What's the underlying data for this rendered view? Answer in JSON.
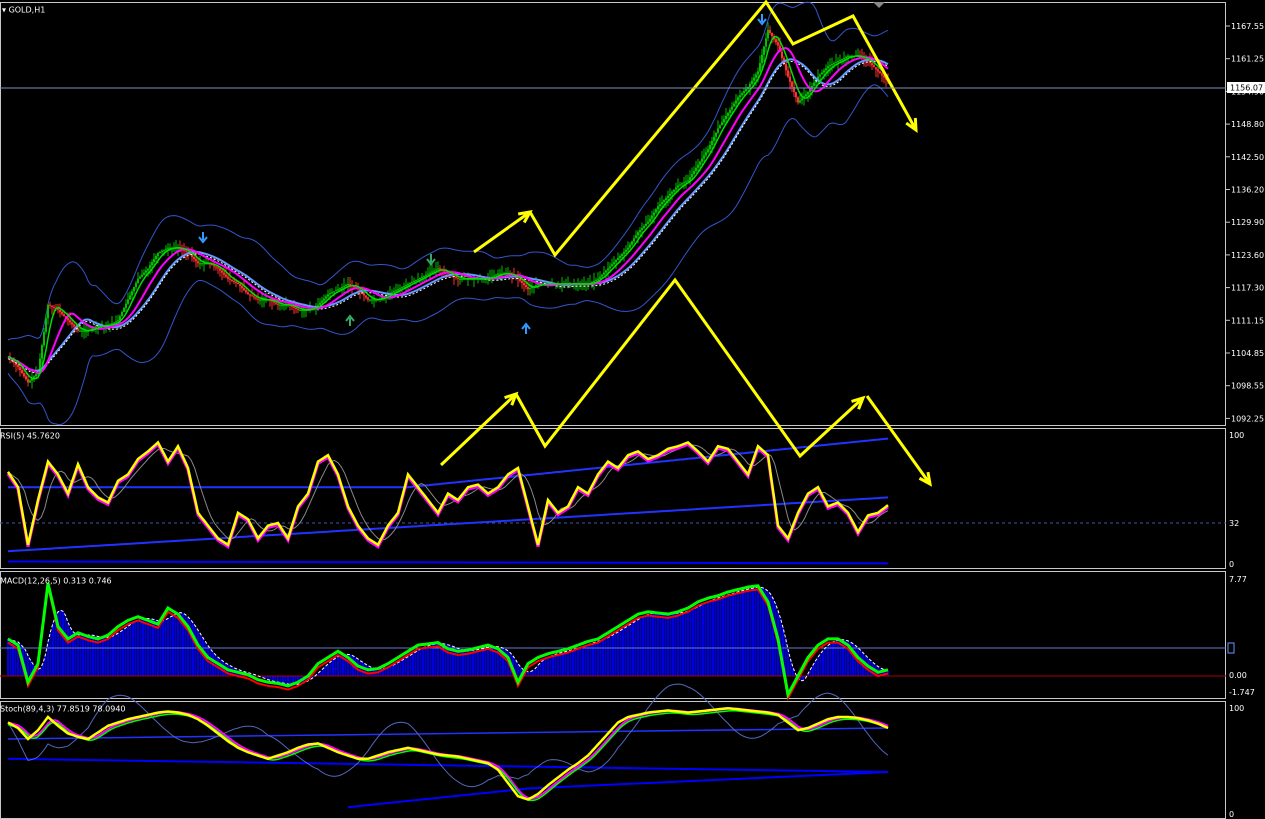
{
  "window": {
    "title": "GOLD,H1",
    "current_price": "1156.07"
  },
  "colors": {
    "background": "#000000",
    "bull_candle": "#00c000",
    "bear_candle": "#ff3030",
    "ma_fast": "#00e000",
    "ma_mid": "#ff00ff",
    "ma_slow": "#6699ff",
    "bands": "#3355cc",
    "rsi_line": "#ffff00",
    "macd_line": "#00ff00",
    "macd_hist": "#0000dd",
    "stoch_k": "#ffff00",
    "annotation_arrows": "#ffff00",
    "up_arrow": "#3399ff",
    "down_arrow": "#3399ff"
  },
  "price_panel": {
    "y_ticks": [
      "1167.55",
      "1161.25",
      "1154.90",
      "1148.80",
      "1142.50",
      "1136.20",
      "1129.90",
      "1123.60",
      "1117.30",
      "1111.15",
      "1104.85",
      "1098.55",
      "1092.25"
    ],
    "y_range": [
      1090,
      1171
    ]
  },
  "rsi_panel": {
    "header": "RSI(5) 45.7620",
    "y_ticks": [
      "100",
      "32",
      "0"
    ],
    "level": 32
  },
  "macd_panel": {
    "header": "MACD(12,26,5) 0.313 0.746",
    "y_ticks": [
      "7.77",
      "0.00",
      "-1.747"
    ],
    "marker": "0"
  },
  "stoch_panel": {
    "header": "Stoch(89,4,3) 77.8519 78.0940",
    "y_ticks": [
      "100",
      "0"
    ]
  },
  "chart_data": [
    {
      "type": "line",
      "panel": "price",
      "series": [
        {
          "name": "GOLD,H1",
          "x": [
            0,
            10,
            20,
            30,
            40,
            50,
            60,
            70,
            80,
            90,
            100,
            110,
            120,
            130,
            140,
            150,
            160,
            170,
            180,
            190,
            200,
            210,
            220,
            230,
            240,
            250,
            260,
            270,
            280,
            290,
            300,
            310,
            320,
            330,
            340,
            350,
            360,
            370,
            380,
            390,
            400,
            410,
            420,
            430,
            440,
            450,
            460,
            470,
            480,
            490,
            500,
            510,
            520,
            530,
            540,
            550,
            560,
            570,
            580,
            590,
            600,
            610,
            620,
            630,
            640,
            650,
            660,
            670,
            680,
            690,
            700,
            710,
            720,
            730,
            740,
            750,
            760,
            770,
            780,
            790,
            800,
            810,
            820,
            830,
            840,
            850,
            860,
            870,
            880
          ],
          "values": [
            1103,
            1101,
            1098,
            1100,
            1113,
            1112,
            1110,
            1108,
            1108,
            1109,
            1109,
            1110,
            1114,
            1118,
            1120,
            1123,
            1124,
            1124,
            1123,
            1121,
            1121,
            1120,
            1118,
            1117,
            1115,
            1114,
            1114,
            1113,
            1113,
            1112,
            1112,
            1113,
            1115,
            1116,
            1117,
            1116,
            1114,
            1114,
            1115,
            1116,
            1117,
            1118,
            1119,
            1120,
            1119,
            1118,
            1118,
            1118,
            1118,
            1119,
            1119,
            1118,
            1116,
            1117,
            1117,
            1117,
            1117,
            1117,
            1117,
            1118,
            1120,
            1122,
            1124,
            1127,
            1129,
            1132,
            1134,
            1136,
            1137,
            1140,
            1143,
            1147,
            1150,
            1153,
            1155,
            1158,
            1166,
            1163,
            1157,
            1152,
            1154,
            1157,
            1159,
            1160,
            1161,
            1161,
            1160,
            1158,
            1156
          ]
        }
      ]
    },
    {
      "type": "line",
      "panel": "rsi",
      "series": [
        {
          "name": "RSI(5)",
          "x": [
            0,
            10,
            20,
            30,
            40,
            50,
            60,
            70,
            80,
            90,
            100,
            110,
            120,
            130,
            140,
            150,
            160,
            170,
            180,
            190,
            200,
            210,
            220,
            230,
            240,
            250,
            260,
            270,
            280,
            290,
            300,
            310,
            320,
            330,
            340,
            350,
            360,
            370,
            380,
            390,
            400,
            410,
            420,
            430,
            440,
            450,
            460,
            470,
            480,
            490,
            500,
            510,
            520,
            530,
            540,
            550,
            560,
            570,
            580,
            590,
            600,
            610,
            620,
            630,
            640,
            650,
            660,
            670,
            680,
            690,
            700,
            710,
            720,
            730,
            740,
            750,
            760,
            770,
            780,
            790,
            800,
            810,
            820,
            830,
            840,
            850,
            860,
            870,
            880
          ],
          "values": [
            72,
            60,
            15,
            50,
            80,
            70,
            55,
            78,
            60,
            52,
            48,
            65,
            70,
            82,
            88,
            95,
            80,
            92,
            75,
            40,
            30,
            20,
            15,
            40,
            35,
            20,
            30,
            32,
            20,
            45,
            55,
            80,
            85,
            70,
            45,
            30,
            20,
            15,
            30,
            40,
            70,
            60,
            50,
            40,
            55,
            50,
            60,
            62,
            55,
            60,
            70,
            75,
            45,
            15,
            50,
            40,
            45,
            60,
            55,
            70,
            80,
            75,
            85,
            88,
            82,
            85,
            90,
            92,
            95,
            88,
            80,
            92,
            90,
            80,
            70,
            92,
            85,
            30,
            20,
            40,
            55,
            60,
            45,
            48,
            40,
            25,
            38,
            40,
            46
          ]
        }
      ]
    },
    {
      "type": "line",
      "panel": "macd",
      "series": [
        {
          "name": "MACD",
          "x": [
            0,
            10,
            20,
            30,
            40,
            50,
            60,
            70,
            80,
            90,
            100,
            110,
            120,
            130,
            140,
            150,
            160,
            170,
            180,
            190,
            200,
            210,
            220,
            230,
            240,
            250,
            260,
            270,
            280,
            290,
            300,
            310,
            320,
            330,
            340,
            350,
            360,
            370,
            380,
            390,
            400,
            410,
            420,
            430,
            440,
            450,
            460,
            470,
            480,
            490,
            500,
            510,
            520,
            530,
            540,
            550,
            560,
            570,
            580,
            590,
            600,
            610,
            620,
            630,
            640,
            650,
            660,
            670,
            680,
            690,
            700,
            710,
            720,
            730,
            740,
            750,
            760,
            770,
            780,
            790,
            800,
            810,
            820,
            830,
            840,
            850,
            860,
            870,
            880
          ],
          "values": [
            3,
            2.5,
            -0.5,
            1,
            7.5,
            4,
            3,
            3.5,
            3.2,
            3,
            3.3,
            4,
            4.5,
            4.8,
            4.5,
            4.2,
            5.5,
            5,
            4,
            2.5,
            1.5,
            1,
            0.5,
            0.3,
            0.1,
            -0.3,
            -0.5,
            -0.6,
            -0.8,
            -0.5,
            0,
            1,
            1.5,
            2,
            1.5,
            0.8,
            0.5,
            0.6,
            1,
            1.5,
            2,
            2.5,
            2.6,
            2.7,
            2.2,
            2,
            2.1,
            2.3,
            2.5,
            2.2,
            1.5,
            -0.5,
            1,
            1.5,
            1.8,
            2,
            2.2,
            2.5,
            2.8,
            3,
            3.5,
            4,
            4.5,
            5,
            5.2,
            5.1,
            5,
            5.2,
            5.5,
            6,
            6.3,
            6.5,
            6.8,
            7,
            7.2,
            7.3,
            6,
            3,
            -1.5,
            0,
            1.5,
            2.5,
            3,
            3,
            2.5,
            1.5,
            0.8,
            0.3,
            0.5
          ]
        }
      ]
    },
    {
      "type": "line",
      "panel": "stoch",
      "series": [
        {
          "name": "Stoch",
          "x": [
            0,
            10,
            20,
            30,
            40,
            50,
            60,
            70,
            80,
            90,
            100,
            110,
            120,
            130,
            140,
            150,
            160,
            170,
            180,
            190,
            200,
            210,
            220,
            230,
            240,
            250,
            260,
            270,
            280,
            290,
            300,
            310,
            320,
            330,
            340,
            350,
            360,
            370,
            380,
            390,
            400,
            410,
            420,
            430,
            440,
            450,
            460,
            470,
            480,
            490,
            500,
            510,
            520,
            530,
            540,
            550,
            560,
            570,
            580,
            590,
            600,
            610,
            620,
            630,
            640,
            650,
            660,
            670,
            680,
            690,
            700,
            710,
            720,
            730,
            740,
            750,
            760,
            770,
            780,
            790,
            800,
            810,
            820,
            830,
            840,
            850,
            860,
            870,
            880
          ],
          "values": [
            85,
            80,
            70,
            78,
            90,
            82,
            75,
            72,
            70,
            76,
            82,
            85,
            88,
            90,
            92,
            94,
            95,
            94,
            92,
            88,
            82,
            75,
            68,
            62,
            58,
            55,
            52,
            55,
            58,
            62,
            65,
            66,
            62,
            58,
            55,
            52,
            52,
            55,
            58,
            60,
            62,
            60,
            58,
            56,
            55,
            54,
            52,
            50,
            48,
            42,
            30,
            18,
            15,
            20,
            28,
            35,
            42,
            48,
            55,
            65,
            75,
            85,
            90,
            92,
            94,
            95,
            96,
            95,
            94,
            95,
            96,
            97,
            98,
            97,
            96,
            95,
            94,
            92,
            85,
            78,
            80,
            84,
            88,
            90,
            90,
            89,
            87,
            84,
            80
          ]
        }
      ]
    }
  ]
}
